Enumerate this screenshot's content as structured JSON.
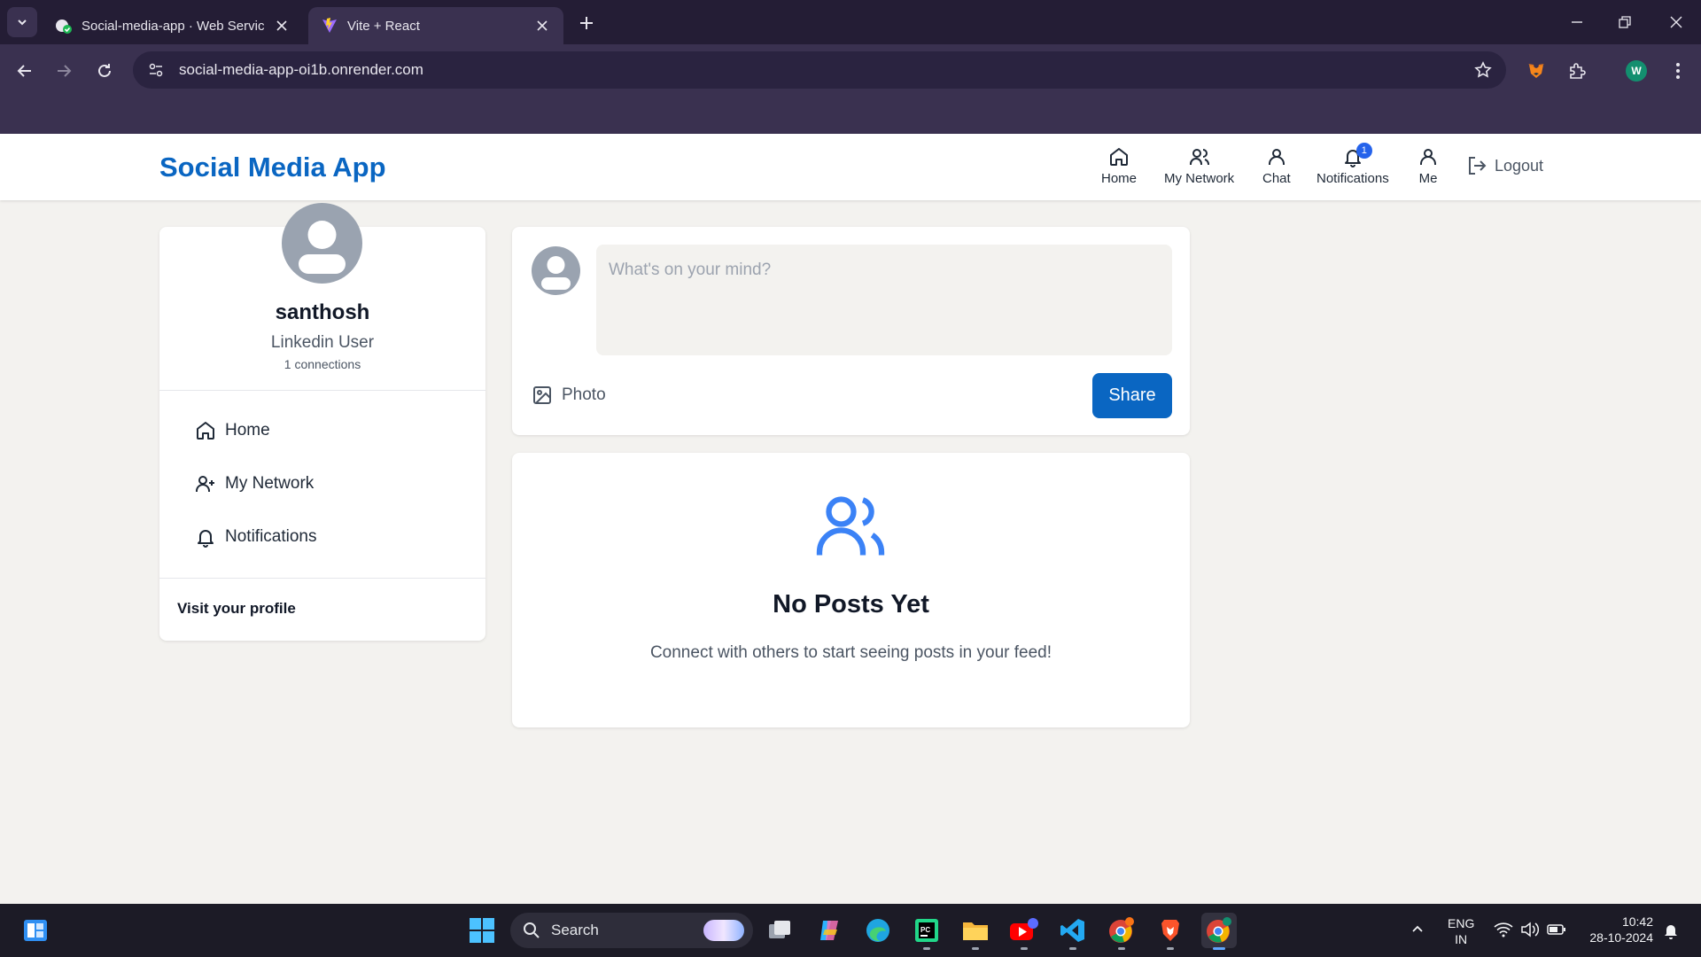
{
  "browser": {
    "tabs": [
      {
        "title": "Social-media-app · Web Servic",
        "active": false
      },
      {
        "title": "Vite + React",
        "active": true
      }
    ],
    "url": "social-media-app-oi1b.onrender.com",
    "profile_initial": "W"
  },
  "app": {
    "brand": "Social Media App",
    "brand_color": "#0a66c2",
    "nav": [
      {
        "label": "Home",
        "icon": "home-icon"
      },
      {
        "label": "My Network",
        "icon": "users-icon"
      },
      {
        "label": "Chat",
        "icon": "user-icon"
      },
      {
        "label": "Notifications",
        "icon": "bell-icon",
        "badge": "1"
      },
      {
        "label": "Me",
        "icon": "user-icon"
      }
    ],
    "logout_label": "Logout"
  },
  "profile": {
    "name": "santhosh",
    "headline": "Linkedin User",
    "connections": "1 connections",
    "links": [
      {
        "label": "Home",
        "icon": "home-icon"
      },
      {
        "label": "My Network",
        "icon": "user-plus-icon"
      },
      {
        "label": "Notifications",
        "icon": "bell-icon"
      }
    ],
    "visit_label": "Visit your profile"
  },
  "composer": {
    "placeholder": "What's on your mind?",
    "photo_label": "Photo",
    "share_label": "Share"
  },
  "feed": {
    "empty_title": "No Posts Yet",
    "empty_subtitle": "Connect with others to start seeing posts in your feed!"
  },
  "taskbar": {
    "search_label": "Search",
    "language": [
      "ENG",
      "IN"
    ],
    "time": "10:42",
    "date": "28-10-2024"
  }
}
